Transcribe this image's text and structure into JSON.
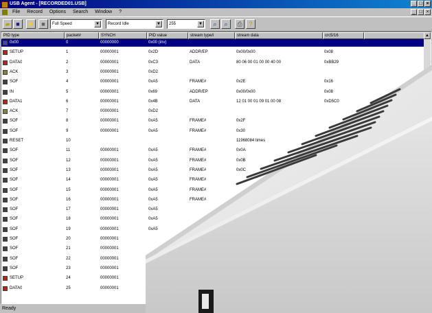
{
  "window": {
    "title": "USB Agent - [RECORDED01.USB]",
    "controls": [
      "_",
      "□",
      "×"
    ]
  },
  "menu": {
    "items": [
      "File",
      "Record",
      "Options",
      "Search",
      "Window",
      "?"
    ],
    "mdi_controls": [
      "_",
      "□",
      "×"
    ]
  },
  "toolbar": {
    "speed": "Full Speed",
    "mode": "Record Idle",
    "count": "255"
  },
  "table": {
    "columns": [
      "PID type",
      "packet#",
      "SYNCH",
      "PID value",
      "stream type/i",
      "stream data",
      "crc5/16"
    ],
    "rows": [
      {
        "pid": "0x00",
        "packet": "0",
        "synch": "00000000",
        "pid_value": "0x00 (inv)",
        "stream_type": "",
        "data": "",
        "crc": "",
        "icon": "#4040c0",
        "selected": true
      },
      {
        "pid": "SETUP",
        "packet": "1",
        "synch": "00000001",
        "pid_value": "0x2D",
        "stream_type": "ADDR/EP",
        "data": "0x00/0x00",
        "crc": "0x08",
        "icon": "#c02020"
      },
      {
        "pid": "DATA0",
        "packet": "2",
        "synch": "00000001",
        "pid_value": "0xC3",
        "stream_type": "DATA",
        "data": "80 06 00 01 00 00 40 00",
        "crc": "0xBB29",
        "icon": "#c02020"
      },
      {
        "pid": "ACK",
        "packet": "3",
        "synch": "00000001",
        "pid_value": "0xD2",
        "stream_type": "",
        "data": "",
        "crc": "",
        "icon": "#808040"
      },
      {
        "pid": "SOF",
        "packet": "4",
        "synch": "00000001",
        "pid_value": "0xA5",
        "stream_type": "FRAME#",
        "data": "0x2E",
        "crc": "0x16",
        "icon": "#404040"
      },
      {
        "pid": "IN",
        "packet": "5",
        "synch": "00000001",
        "pid_value": "0x69",
        "stream_type": "ADDR/EP",
        "data": "0x00/0x00",
        "crc": "0x08",
        "icon": "#404040"
      },
      {
        "pid": "DATA1",
        "packet": "6",
        "synch": "00000001",
        "pid_value": "0x4B",
        "stream_type": "DATA",
        "data": "12 01 00 01 09 01 00 08",
        "crc": "0xD5C0",
        "icon": "#c02020"
      },
      {
        "pid": "ACK",
        "packet": "7",
        "synch": "00000001",
        "pid_value": "0xD2",
        "stream_type": "",
        "data": "",
        "crc": "",
        "icon": "#808040"
      },
      {
        "pid": "SOF",
        "packet": "8",
        "synch": "00000001",
        "pid_value": "0xA5",
        "stream_type": "FRAME#",
        "data": "0x2F",
        "crc": "",
        "icon": "#404040"
      },
      {
        "pid": "SOF",
        "packet": "9",
        "synch": "00000001",
        "pid_value": "0xA5",
        "stream_type": "FRAME#",
        "data": "0x30",
        "crc": "",
        "icon": "#404040"
      },
      {
        "pid": "RESET",
        "packet": "10",
        "synch": "",
        "pid_value": "",
        "stream_type": "",
        "data": "11968084 times",
        "crc": "",
        "icon": "#404040"
      },
      {
        "pid": "SOF",
        "packet": "11",
        "synch": "00000001",
        "pid_value": "0xA5",
        "stream_type": "FRAME#",
        "data": "0x0A",
        "crc": "",
        "icon": "#404040"
      },
      {
        "pid": "SOF",
        "packet": "12",
        "synch": "00000001",
        "pid_value": "0xA5",
        "stream_type": "FRAME#",
        "data": "0x0B",
        "crc": "",
        "icon": "#404040"
      },
      {
        "pid": "SOF",
        "packet": "13",
        "synch": "00000001",
        "pid_value": "0xA5",
        "stream_type": "FRAME#",
        "data": "0x0C",
        "crc": "",
        "icon": "#404040"
      },
      {
        "pid": "SOF",
        "packet": "14",
        "synch": "00000001",
        "pid_value": "0xA5",
        "stream_type": "FRAME#",
        "data": "",
        "crc": "",
        "icon": "#404040"
      },
      {
        "pid": "SOF",
        "packet": "15",
        "synch": "00000001",
        "pid_value": "0xA5",
        "stream_type": "FRAME#",
        "data": "",
        "crc": "",
        "icon": "#404040"
      },
      {
        "pid": "SOF",
        "packet": "16",
        "synch": "00000001",
        "pid_value": "0xA5",
        "stream_type": "FRAME#",
        "data": "",
        "crc": "",
        "icon": "#404040"
      },
      {
        "pid": "SOF",
        "packet": "17",
        "synch": "00000001",
        "pid_value": "0xA5",
        "stream_type": "",
        "data": "",
        "crc": "",
        "icon": "#404040"
      },
      {
        "pid": "SOF",
        "packet": "18",
        "synch": "00000001",
        "pid_value": "0xA5",
        "stream_type": "",
        "data": "",
        "crc": "",
        "icon": "#404040"
      },
      {
        "pid": "SOF",
        "packet": "19",
        "synch": "00000001",
        "pid_value": "0xA5",
        "stream_type": "",
        "data": "",
        "crc": "",
        "icon": "#404040"
      },
      {
        "pid": "SOF",
        "packet": "20",
        "synch": "00000001",
        "pid_value": "",
        "stream_type": "",
        "data": "",
        "crc": "",
        "icon": "#404040"
      },
      {
        "pid": "SOF",
        "packet": "21",
        "synch": "00000001",
        "pid_value": "",
        "stream_type": "",
        "data": "",
        "crc": "",
        "icon": "#404040"
      },
      {
        "pid": "SOF",
        "packet": "22",
        "synch": "00000001",
        "pid_value": "",
        "stream_type": "",
        "data": "",
        "crc": "",
        "icon": "#404040"
      },
      {
        "pid": "SOF",
        "packet": "23",
        "synch": "00000001",
        "pid_value": "",
        "stream_type": "",
        "data": "",
        "crc": "",
        "icon": "#404040"
      },
      {
        "pid": "SETUP",
        "packet": "24",
        "synch": "00000001",
        "pid_value": "",
        "stream_type": "",
        "data": "",
        "crc": "",
        "icon": "#c02020"
      },
      {
        "pid": "DATA0",
        "packet": "25",
        "synch": "00000001",
        "pid_value": "",
        "stream_type": "",
        "data": "",
        "crc": "",
        "icon": "#c02020"
      }
    ]
  },
  "status": {
    "text": "Ready"
  },
  "colors": {
    "selection": "#000080",
    "titlebar": "#000080"
  }
}
